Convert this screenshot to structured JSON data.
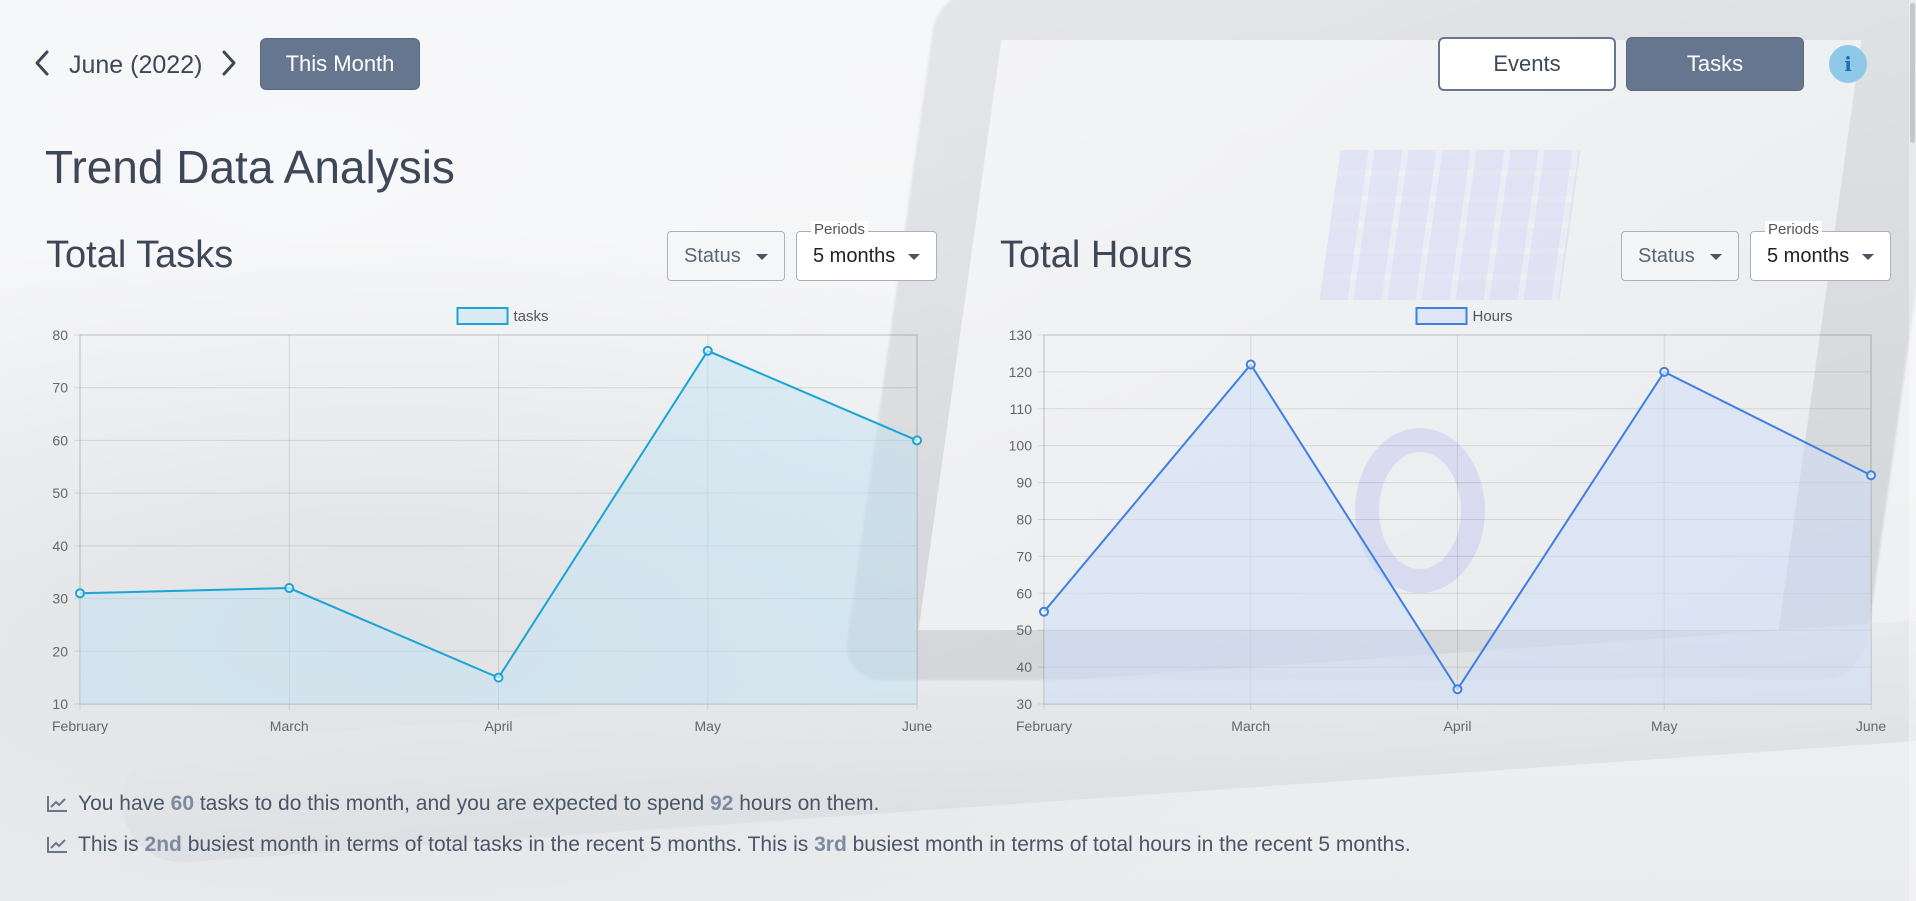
{
  "header": {
    "month": "June",
    "year": "(2022)",
    "this_month_label": "This Month",
    "events_label": "Events",
    "tasks_label": "Tasks",
    "info_icon": "i"
  },
  "page_title": "Trend Data Analysis",
  "tasks_section": {
    "title": "Total Tasks",
    "status_label": "Status",
    "periods_legend": "Periods",
    "periods_value": "5 months"
  },
  "hours_section": {
    "title": "Total Hours",
    "status_label": "Status",
    "periods_legend": "Periods",
    "periods_value": "5 months"
  },
  "chart_data": [
    {
      "type": "area",
      "categories": [
        "February",
        "March",
        "April",
        "May",
        "June"
      ],
      "series": [
        {
          "name": "tasks",
          "values": [
            31,
            32,
            15,
            77,
            60
          ]
        }
      ],
      "ylim": [
        10,
        80
      ],
      "yticks": [
        10,
        20,
        30,
        40,
        50,
        60,
        70,
        80
      ],
      "grid": true,
      "legend": "top-center",
      "color": "#1ba4d4",
      "fill": "rgba(190,226,244,0.45)"
    },
    {
      "type": "area",
      "categories": [
        "February",
        "March",
        "April",
        "May",
        "June"
      ],
      "series": [
        {
          "name": "Hours",
          "values": [
            55,
            122,
            34,
            120,
            92
          ]
        }
      ],
      "ylim": [
        30,
        130
      ],
      "yticks": [
        30,
        40,
        50,
        60,
        70,
        80,
        90,
        100,
        110,
        120,
        130
      ],
      "grid": true,
      "legend": "top-center",
      "color": "#3f7fe0",
      "fill": "rgba(205,222,250,0.5)"
    }
  ],
  "summary": {
    "line1": {
      "a": "You have ",
      "b": "60",
      "c": " tasks to do this month, and you are expected to spend ",
      "d": "92",
      "e": " hours on them."
    },
    "line2": {
      "a": "This is ",
      "b": "2nd",
      "c": " busiest month in terms of total tasks in the recent 5 months. This is ",
      "d": "3rd",
      "e": " busiest month in terms of total hours in the recent 5 months."
    }
  }
}
